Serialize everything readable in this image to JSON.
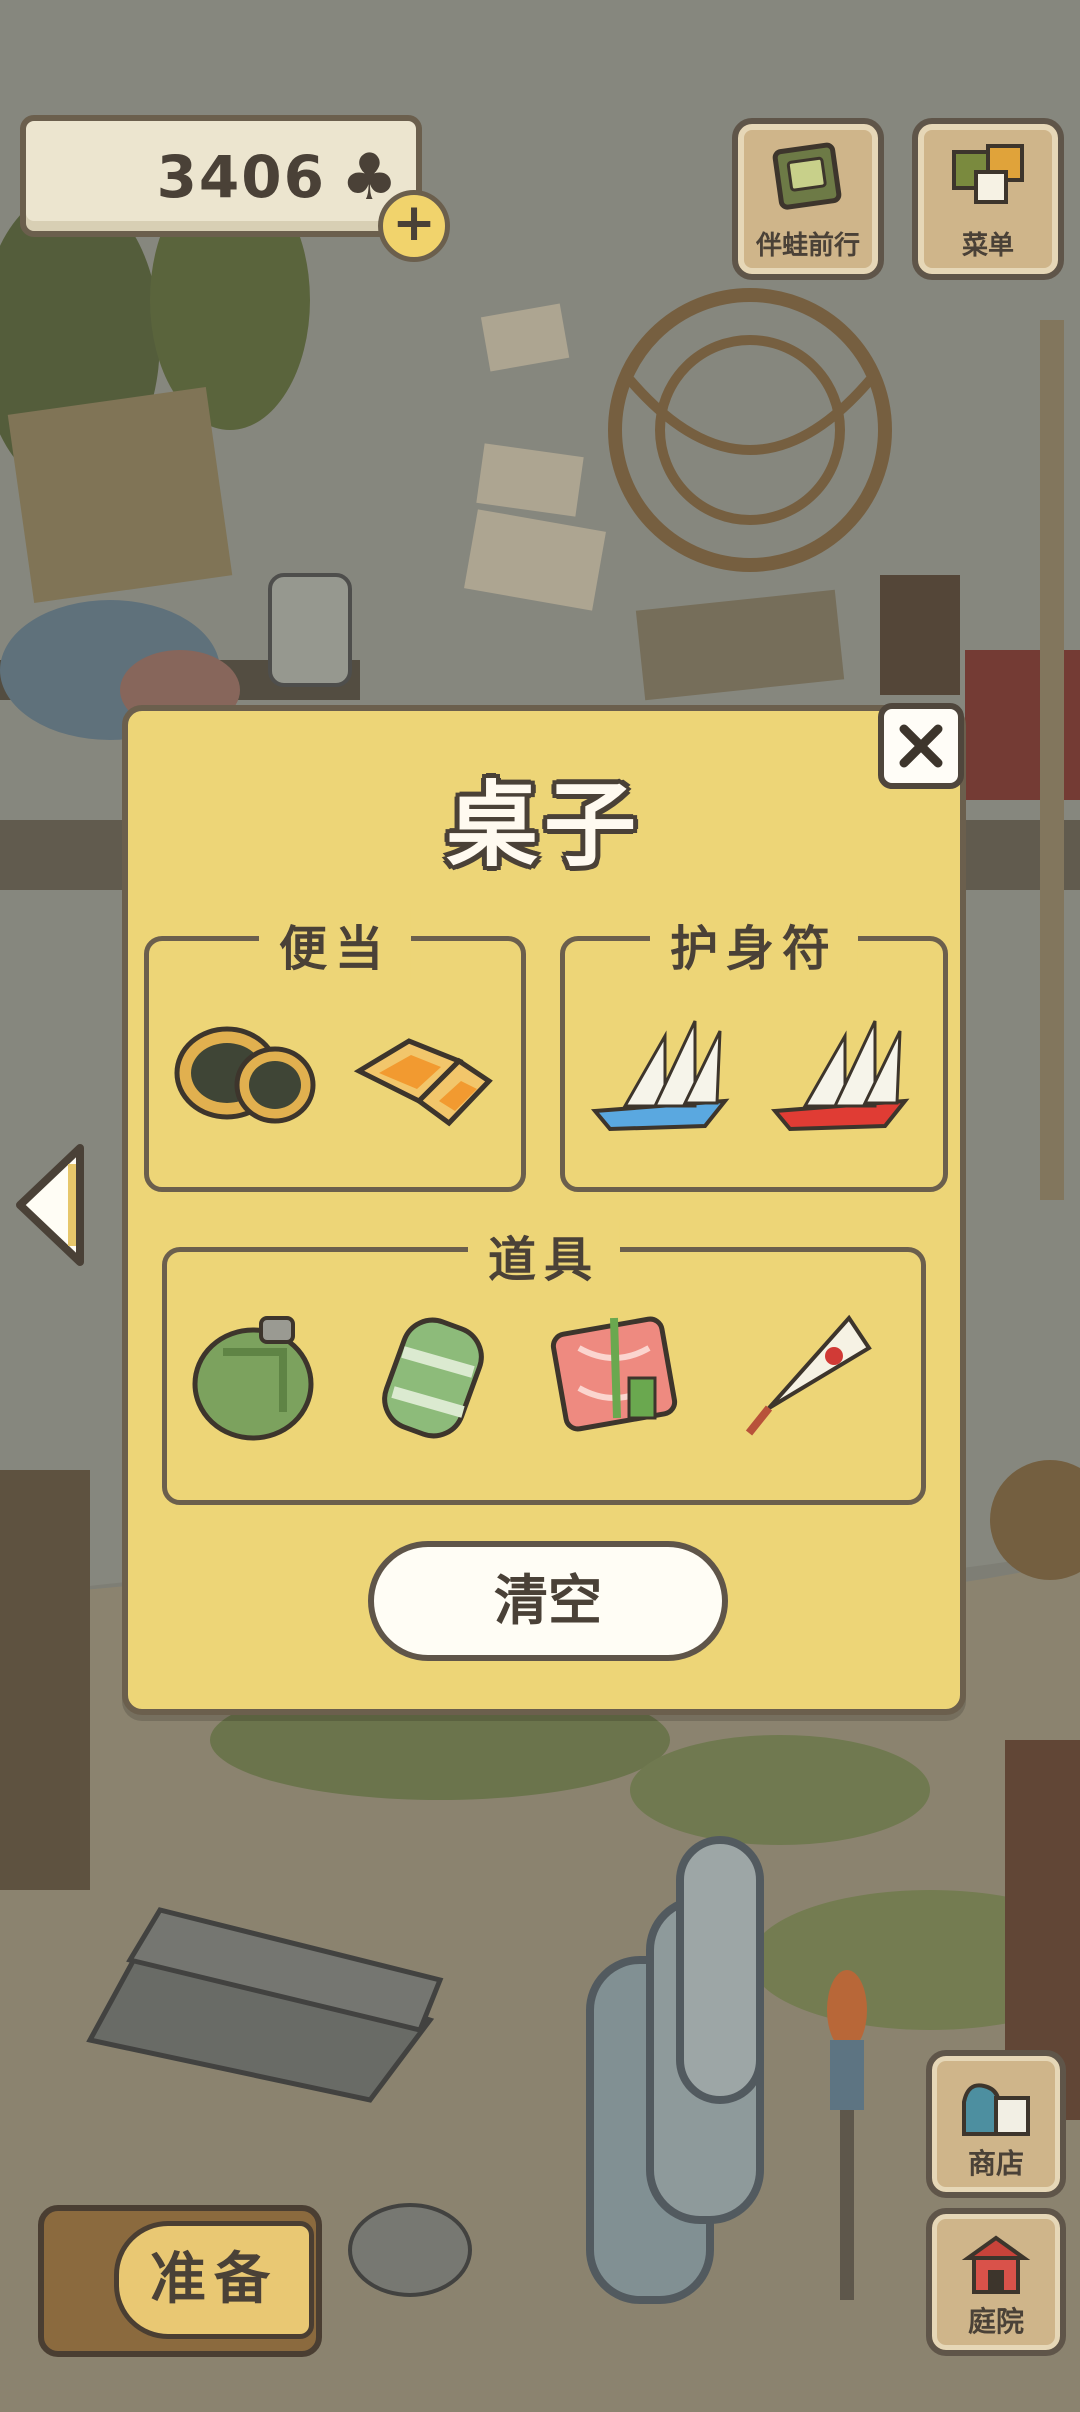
{
  "hud": {
    "clover_count": "3406",
    "clover_symbol": "♣",
    "add_symbol": "+"
  },
  "top_buttons": {
    "travel_label": "伴蛙前行",
    "menu_label": "菜单"
  },
  "dialog": {
    "title": "桌子",
    "groups": {
      "bento": {
        "label": "便当",
        "items": [
          "black-sesame-bun",
          "orange-mooncake"
        ]
      },
      "amulet": {
        "label": "护身符",
        "items": [
          "blue-paper-boat",
          "red-paper-boat"
        ]
      },
      "tools": {
        "label": "道具",
        "items": [
          "green-canteen",
          "green-sleeping-roll",
          "pink-wrapped-lunch",
          "paper-umbrella"
        ]
      }
    },
    "clear_label": "清空",
    "close_symbol": "✕"
  },
  "bottom": {
    "prepare_label": "准备",
    "shop_label": "商店",
    "garden_label": "庭院"
  },
  "colors": {
    "dialog_bg": "#edd577",
    "outline": "#4a4137",
    "button_bg": "#cfb58a"
  }
}
